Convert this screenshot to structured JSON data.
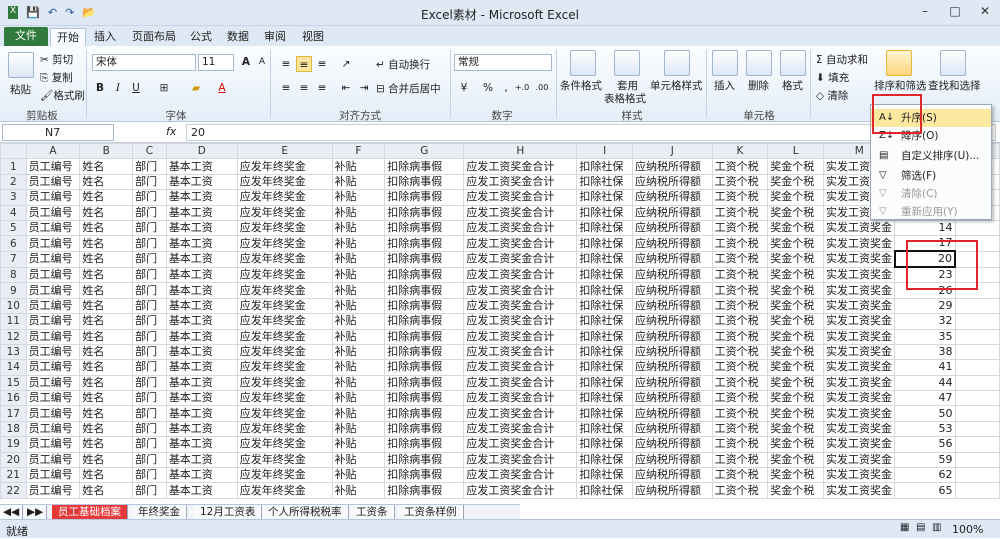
{
  "window": {
    "title": "Excel素材 - Microsoft Excel",
    "min": "–",
    "max": "□",
    "close": "✕"
  },
  "qat": {
    "save": "💾",
    "undo": "↶",
    "redo": "↷",
    "open": "📂"
  },
  "tabs": [
    "文件",
    "开始",
    "插入",
    "页面布局",
    "公式",
    "数据",
    "审阅",
    "视图"
  ],
  "clipboard": {
    "paste": "粘贴",
    "cut": "剪切",
    "copy": "复制",
    "painter": "格式刷",
    "label": "剪贴板"
  },
  "font": {
    "name": "宋体",
    "size": "11",
    "bold": "B",
    "italic": "I",
    "underline": "U",
    "label": "字体",
    "grow": "A",
    "shrink": "A",
    "color_a": "A"
  },
  "alignment": {
    "wrap": "自动换行",
    "merge": "合并后居中",
    "label": "对齐方式"
  },
  "number": {
    "format": "常规",
    "percent": "%",
    "comma": ",",
    "inc": "+.0",
    "dec": ".00",
    "label": "数字"
  },
  "styles": {
    "cond": "条件格式",
    "table_line1": "套用",
    "table_line2": "表格格式",
    "cell": "单元格样式",
    "label": "样式"
  },
  "cells": {
    "insert": "插入",
    "delete": "删除",
    "format": "格式",
    "label": "单元格"
  },
  "editing": {
    "autosum": "自动求和",
    "fill": "填充",
    "clear": "清除",
    "sort": "排序和筛选",
    "find": "查找和选择",
    "sigma": "Σ"
  },
  "formula_bar": {
    "name_box": "N7",
    "fx": "fx",
    "value": "20"
  },
  "columns": [
    "A",
    "B",
    "C",
    "D",
    "E",
    "F",
    "G",
    "H",
    "I",
    "J",
    "K",
    "L",
    "M",
    "N",
    "O"
  ],
  "header_row": [
    "员工编号",
    "姓名",
    "部门",
    "基本工资",
    "应发年终奖金",
    "补贴",
    "扣除病事假",
    "应发工资奖金合计",
    "扣除社保",
    "应纳税所得额",
    "工资个税",
    "奖金个税",
    "实发工资奖金"
  ],
  "rows": [
    {
      "n": "1",
      "v": ""
    },
    {
      "n": "2",
      "v": ""
    },
    {
      "n": "3",
      "v": ""
    },
    {
      "n": "4",
      "v": ""
    },
    {
      "n": "5",
      "v": "14"
    },
    {
      "n": "6",
      "v": "17"
    },
    {
      "n": "7",
      "v": "20"
    },
    {
      "n": "8",
      "v": "23"
    },
    {
      "n": "9",
      "v": "26"
    },
    {
      "n": "10",
      "v": "29"
    },
    {
      "n": "11",
      "v": "32"
    },
    {
      "n": "12",
      "v": "35"
    },
    {
      "n": "13",
      "v": "38"
    },
    {
      "n": "14",
      "v": "41"
    },
    {
      "n": "15",
      "v": "44"
    },
    {
      "n": "16",
      "v": "47"
    },
    {
      "n": "17",
      "v": "50"
    },
    {
      "n": "18",
      "v": "53"
    },
    {
      "n": "19",
      "v": "56"
    },
    {
      "n": "20",
      "v": "59"
    },
    {
      "n": "21",
      "v": "62"
    },
    {
      "n": "22",
      "v": "65"
    }
  ],
  "sort_menu": {
    "asc": "升序(S)",
    "desc": "降序(O)",
    "custom": "自定义排序(U)...",
    "filter": "筛选(F)",
    "clear": "清除(C)",
    "reapply": "重新应用(Y)"
  },
  "sheet_tabs": [
    "员工基础档案",
    "年终奖金",
    "12月工资表",
    "个人所得税税率",
    "工资条",
    "工资条样例"
  ],
  "status": {
    "ready": "就绪",
    "zoom": "100%"
  },
  "colors": {
    "accent": "#2f7a3c",
    "highlight": "#e0262a"
  }
}
